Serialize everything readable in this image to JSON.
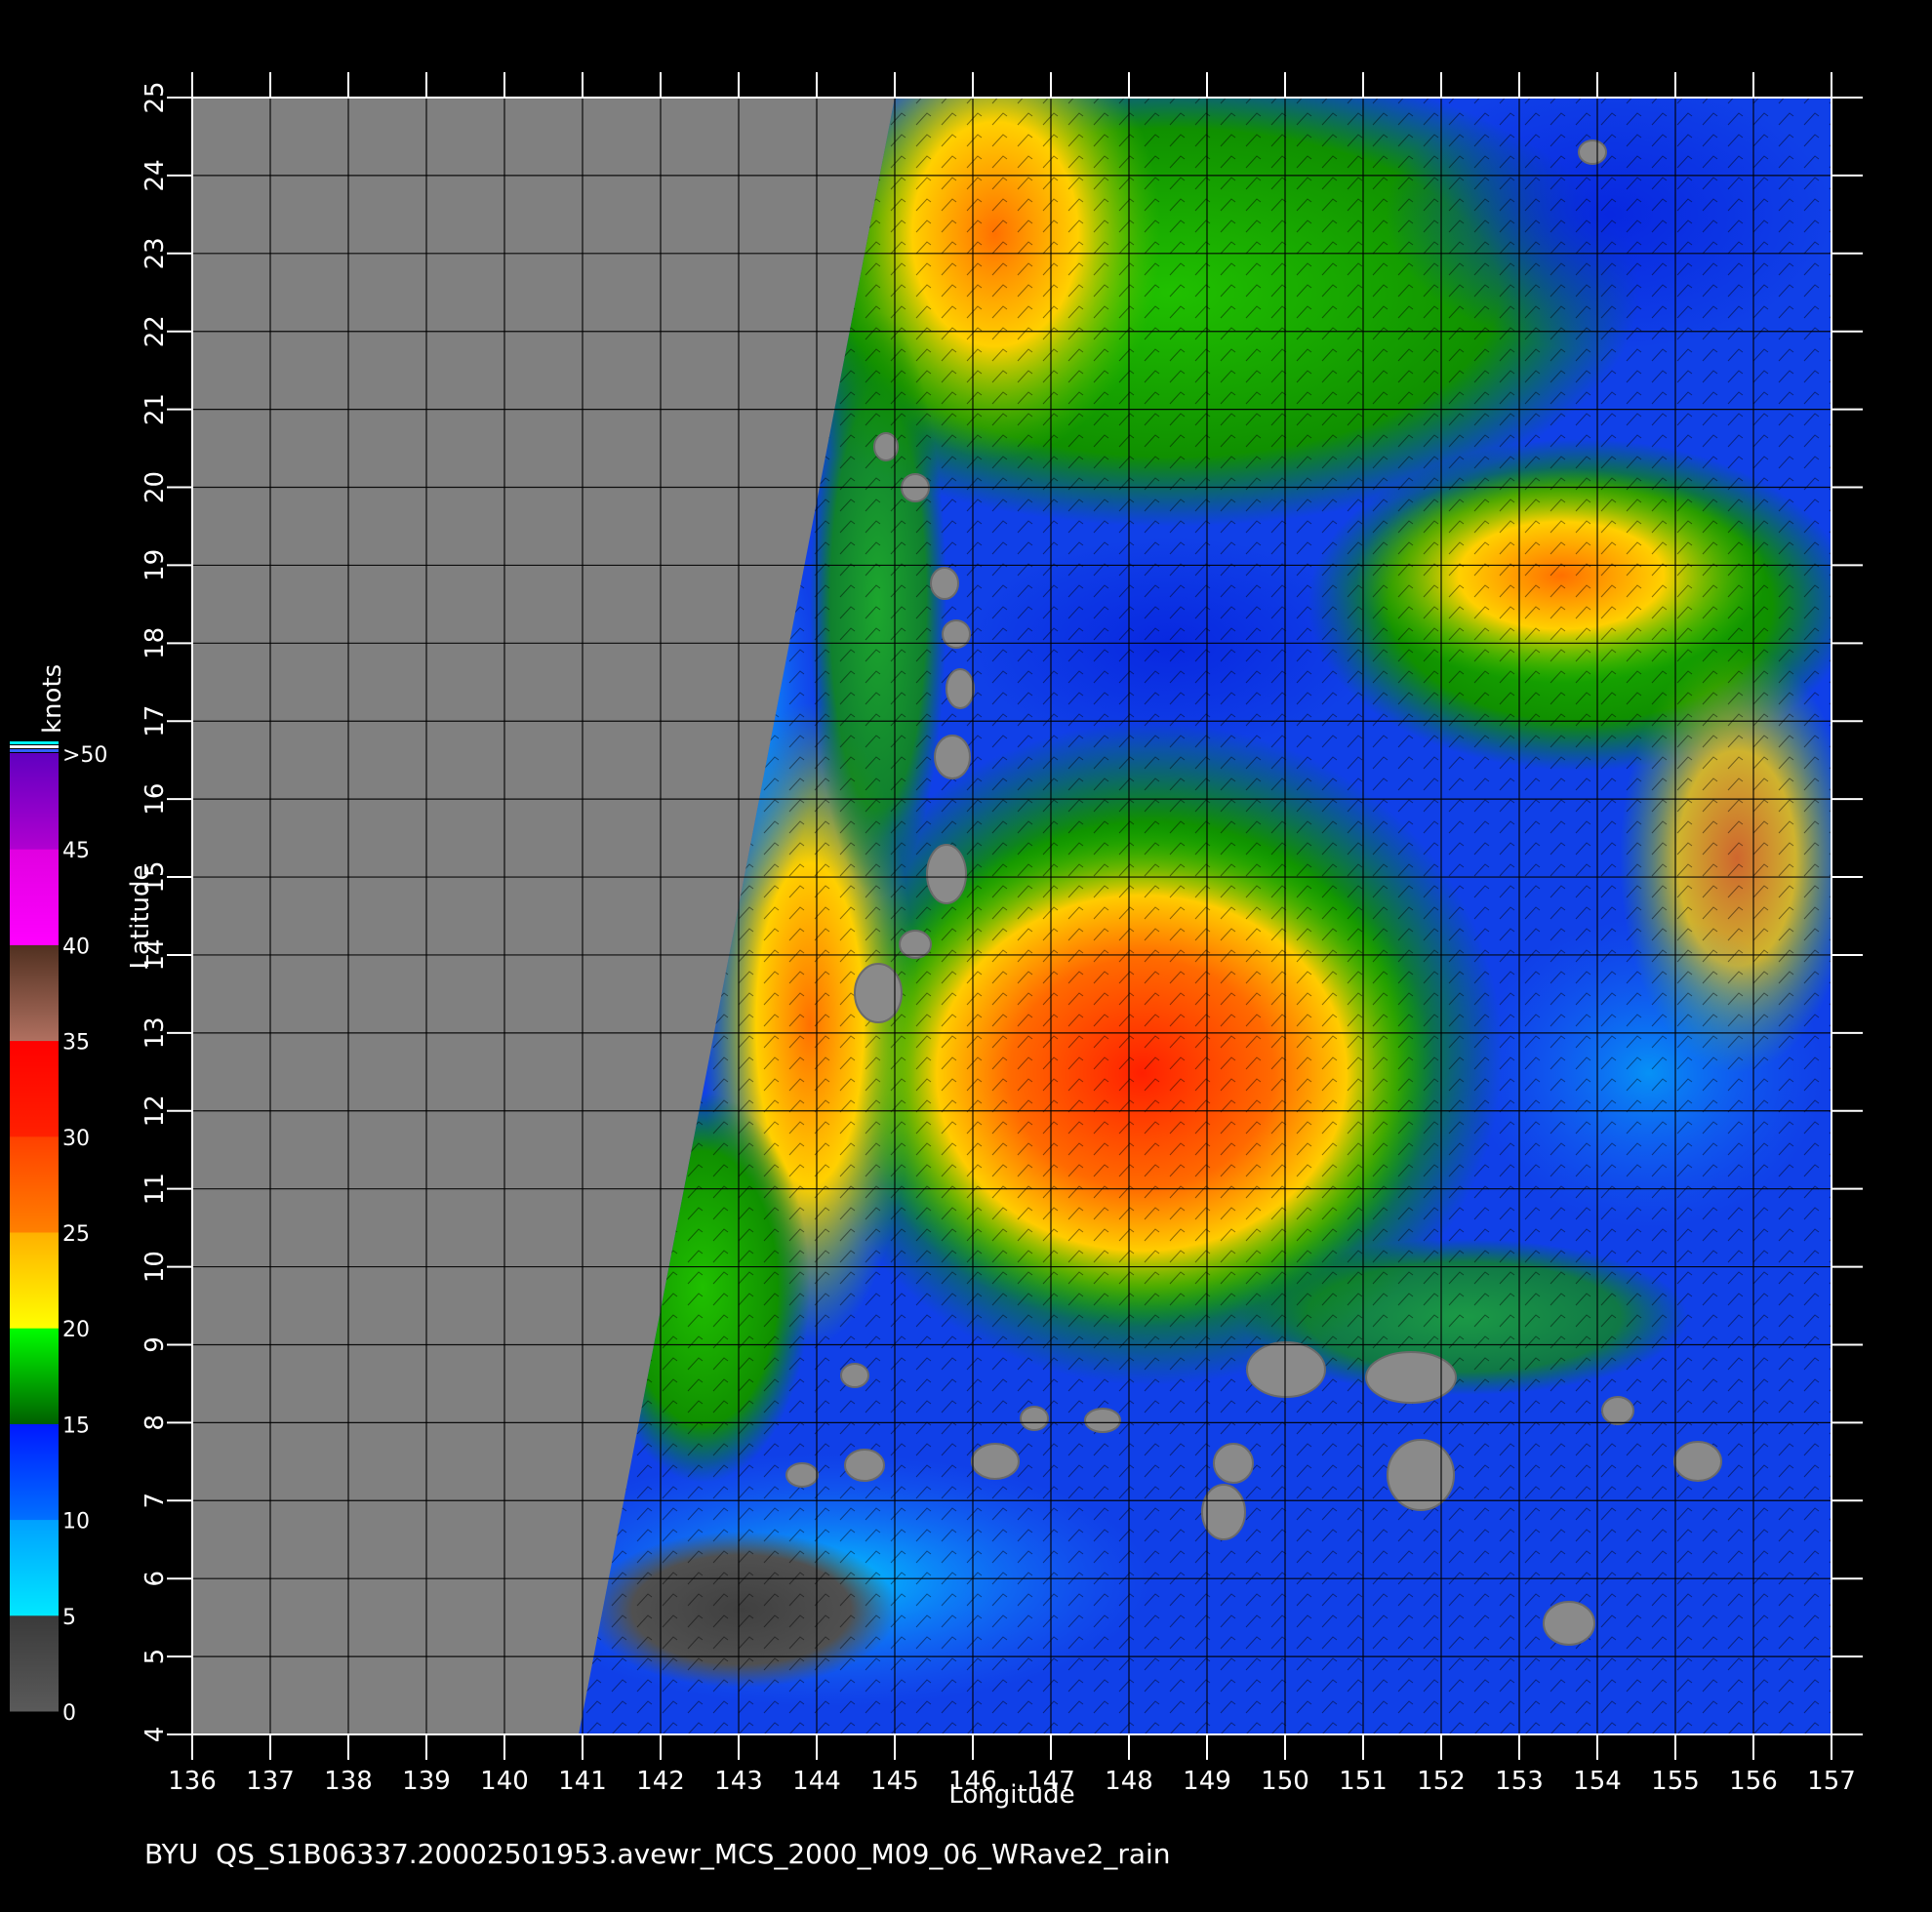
{
  "map": {
    "xlabel": "Longitude",
    "ylabel": "Latitude",
    "lon_range": [
      136,
      157
    ],
    "lat_range": [
      4,
      25
    ],
    "lon_ticks": [
      "136",
      "137",
      "138",
      "139",
      "140",
      "141",
      "142",
      "143",
      "144",
      "145",
      "146",
      "147",
      "148",
      "149",
      "150",
      "151",
      "152",
      "153",
      "154",
      "155",
      "156",
      "157"
    ],
    "lat_ticks": [
      "4",
      "5",
      "6",
      "7",
      "8",
      "9",
      "10",
      "11",
      "12",
      "13",
      "14",
      "15",
      "16",
      "17",
      "18",
      "19",
      "20",
      "21",
      "22",
      "23",
      "24",
      "25"
    ],
    "no_data_color": "#808080",
    "grid": true
  },
  "colorbar": {
    "unit": "knots",
    "labels": [
      "0",
      "5",
      "10",
      "15",
      "20",
      "25",
      "30",
      "35",
      "40",
      "45",
      ">50"
    ],
    "bands": [
      {
        "from": 0,
        "to": 5,
        "colors": [
          "#5a5a5a",
          "#3a3a3a"
        ]
      },
      {
        "from": 5,
        "to": 10,
        "colors": [
          "#00e8ff",
          "#00a0ff"
        ]
      },
      {
        "from": 10,
        "to": 15,
        "colors": [
          "#0070ff",
          "#0018ff"
        ]
      },
      {
        "from": 15,
        "to": 20,
        "colors": [
          "#006000",
          "#00ff00"
        ]
      },
      {
        "from": 20,
        "to": 25,
        "colors": [
          "#ffff00",
          "#ffb000"
        ]
      },
      {
        "from": 25,
        "to": 30,
        "colors": [
          "#ff8000",
          "#ff4000"
        ]
      },
      {
        "from": 30,
        "to": 35,
        "colors": [
          "#ff2000",
          "#ff0000"
        ]
      },
      {
        "from": 35,
        "to": 40,
        "colors": [
          "#b07060",
          "#503020"
        ]
      },
      {
        "from": 40,
        "to": 45,
        "colors": [
          "#ff00ff",
          "#e000e0"
        ]
      },
      {
        "from": 45,
        "to": 50,
        "colors": [
          "#b000d0",
          "#6000c0"
        ]
      }
    ]
  },
  "caption": "BYU  QS_S1B06337.20002501953.avewr_MCS_2000_M09_06_WRave2_rain"
}
